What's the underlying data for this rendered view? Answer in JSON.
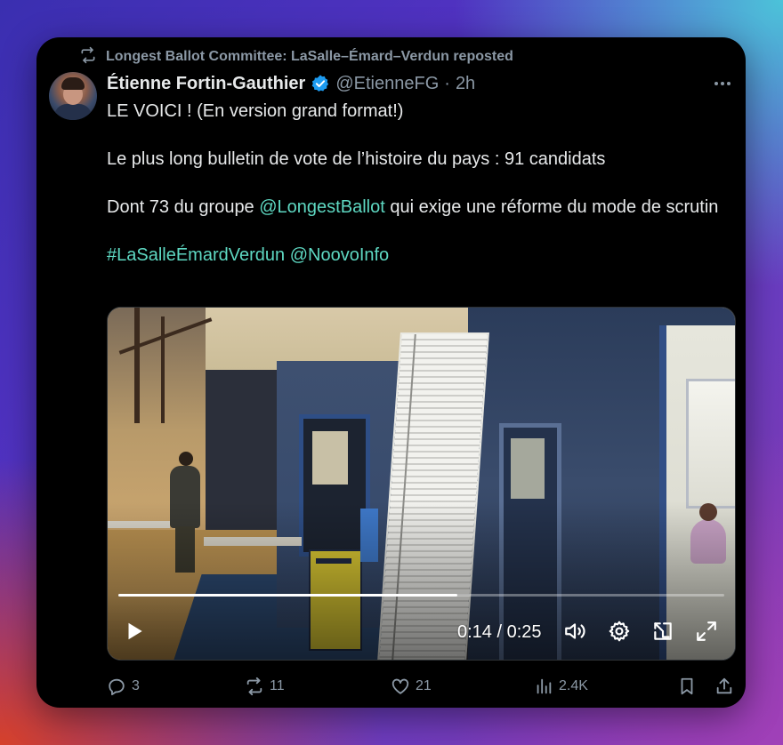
{
  "repost": {
    "text": "Longest Ballot Committee: LaSalle–Émard–Verdun reposted"
  },
  "author": {
    "name": "Étienne Fortin-Gauthier",
    "handle": "@EtienneFG",
    "separator": "·",
    "time": "2h",
    "verified": true
  },
  "tweet": {
    "line1": "LE VOICI ! (En version grand format!)",
    "line2": "Le plus long bulletin de vote de l’histoire du pays : 91 candidats",
    "line3_prefix": "Dont 73 du groupe ",
    "line3_mention": "@LongestBallot",
    "line3_suffix": " qui exige une réforme du mode de scrutin",
    "hashtag": "#LaSalleÉmardVerdun",
    "mention2": "@NoovoInfo"
  },
  "video": {
    "time_label": "0:14 / 0:25",
    "progress": 0.56
  },
  "actions": {
    "replies": "3",
    "reposts": "11",
    "likes": "21",
    "views": "2.4K"
  },
  "colors": {
    "link": "#5ed8c2",
    "verified_badge": "#1d9bf0",
    "muted": "#8b98a5",
    "text": "#e7e9ea",
    "card_bg": "#000000"
  },
  "icons": {
    "repost": "repost-icon",
    "verified": "verified-badge-icon",
    "more": "more-horizontal-icon",
    "play": "play-icon",
    "volume": "volume-icon",
    "settings": "gear-icon",
    "pip": "picture-in-picture-icon",
    "fullscreen": "fullscreen-icon",
    "reply": "reply-icon",
    "like": "heart-icon",
    "views": "views-icon",
    "bookmark": "bookmark-icon",
    "share": "share-icon"
  }
}
